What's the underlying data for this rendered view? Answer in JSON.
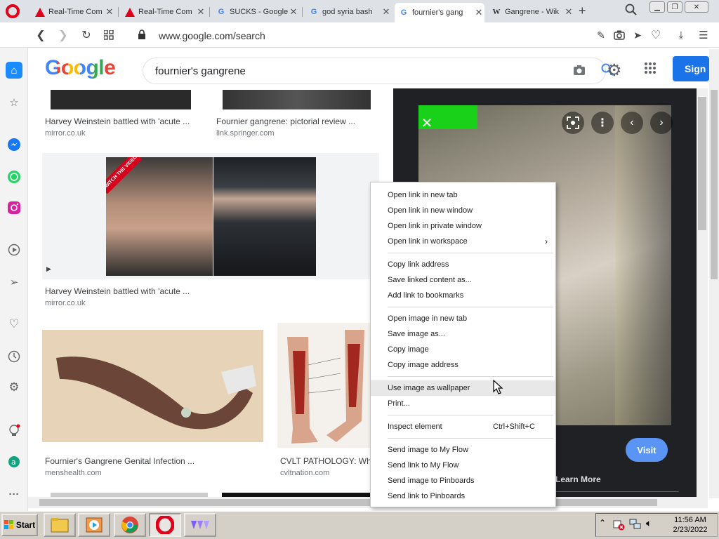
{
  "browser": {
    "tabs": [
      {
        "title": "Real-Time Com",
        "favicon": "warning-triangle-icon"
      },
      {
        "title": "Real-Time Com",
        "favicon": "warning-triangle-icon"
      },
      {
        "title": "SUCKS - Google",
        "favicon": "google-icon"
      },
      {
        "title": "god syria bash",
        "favicon": "google-icon"
      },
      {
        "title": "fournier's gang",
        "favicon": "google-icon",
        "active": true
      },
      {
        "title": "Gangrene - Wik",
        "favicon": "wikipedia-icon"
      }
    ],
    "new_tab": "+",
    "url": "www.google.com/search"
  },
  "google": {
    "logo": "Google",
    "query": "fournier's gangrene",
    "sign_in": "Sign"
  },
  "results": [
    {
      "caption": "Harvey Weinstein battled with 'acute ...",
      "source": "mirror.co.uk"
    },
    {
      "caption": "Fournier gangrene: pictorial review ...",
      "source": "link.springer.com"
    },
    {
      "caption": "Harvey Weinstein battled with 'acute ...",
      "source": "mirror.co.uk",
      "badge": "WATCH THE VIDEO"
    },
    {
      "caption": "Fournier's Gangrene Genital Infection ...",
      "source": "menshealth.com"
    },
    {
      "caption": "CVLT PATHOLOGY: Wh...",
      "source": "cvltnation.com"
    }
  ],
  "preview": {
    "visit": "Visit",
    "learn_more": "Learn More"
  },
  "context_menu": {
    "groups": [
      [
        {
          "label": "Open link in new tab"
        },
        {
          "label": "Open link in new window"
        },
        {
          "label": "Open link in private window"
        },
        {
          "label": "Open link in workspace",
          "submenu": true
        }
      ],
      [
        {
          "label": "Copy link address"
        },
        {
          "label": "Save linked content as..."
        },
        {
          "label": "Add link to bookmarks"
        }
      ],
      [
        {
          "label": "Open image in new tab"
        },
        {
          "label": "Save image as..."
        },
        {
          "label": "Copy image"
        },
        {
          "label": "Copy image address"
        }
      ],
      [
        {
          "label": "Use image as wallpaper",
          "highlighted": true
        },
        {
          "label": "Print..."
        }
      ],
      [
        {
          "label": "Inspect element",
          "shortcut": "Ctrl+Shift+C"
        }
      ],
      [
        {
          "label": "Send image to My Flow"
        },
        {
          "label": "Send link to My Flow"
        },
        {
          "label": "Send image to Pinboards"
        },
        {
          "label": "Send link to Pinboards"
        }
      ]
    ]
  },
  "taskbar": {
    "start": "Start",
    "time": "11:56 AM",
    "date": "2/23/2022"
  },
  "colors": {
    "google_blue": "#4285F4",
    "google_red": "#EA4335",
    "google_yellow": "#FBBC05",
    "google_green": "#34A853",
    "opera_red": "#E0001B",
    "sign_in_blue": "#1A73E8"
  }
}
